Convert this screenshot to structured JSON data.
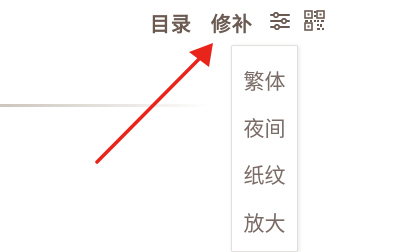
{
  "toolbar": {
    "toc_label": "目录",
    "fix_label": "修补",
    "settings_icon": "sliders-icon",
    "qr_icon": "qr-code-icon"
  },
  "menu": {
    "items": [
      {
        "label": "繁体"
      },
      {
        "label": "夜间"
      },
      {
        "label": "纸纹"
      },
      {
        "label": "放大"
      }
    ]
  },
  "annotation": {
    "arrow_color": "#e8241b",
    "arrow_target": "修补"
  },
  "colors": {
    "toolbar_text": "#6b5a52",
    "menu_text": "#7a6b66",
    "menu_border": "#e3e0dc"
  }
}
